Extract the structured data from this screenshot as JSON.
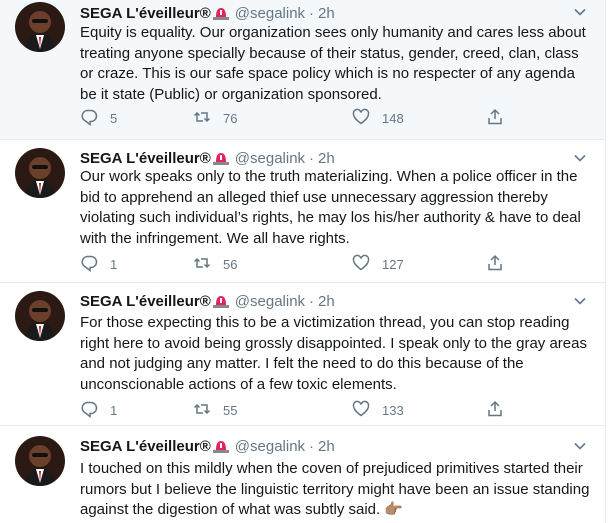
{
  "tweets": [
    {
      "name": "SEGA L'éveilleur®",
      "handle": "@segalink",
      "dot": "·",
      "time": "2h",
      "text": "Equity is equality. Our organization sees only humanity and cares less about treating anyone specially because of their status, gender, creed, clan, class or craze. This is our safe space policy which is no respecter of any agenda be it state (Public) or organization sponsored.",
      "replies": "5",
      "retweets": "76",
      "likes": "148"
    },
    {
      "name": "SEGA L'éveilleur®",
      "handle": "@segalink",
      "dot": "·",
      "time": "2h",
      "text": "Our work speaks only to the truth materializing. When a police officer in the bid to apprehend an alleged thief use unnecessary aggression thereby violating such individual’s rights, he may los his/her authority & have to deal with the infringement. We all have rights.",
      "replies": "1",
      "retweets": "56",
      "likes": "127"
    },
    {
      "name": "SEGA L'éveilleur®",
      "handle": "@segalink",
      "dot": "·",
      "time": "2h",
      "text": "For those expecting this to be a victimization thread, you can stop reading right here to avoid being grossly disappointed. I speak only to the gray areas and not judging any matter. I felt the need to do this because of the unconscionable actions of a few toxic elements.",
      "replies": "1",
      "retweets": "55",
      "likes": "133"
    },
    {
      "name": "SEGA L'éveilleur®",
      "handle": "@segalink",
      "dot": "·",
      "time": "2h",
      "text": "I touched on this mildly when the coven of prejudiced primitives started their rumors but I believe the linguistic territory might have been an issue standing against the digestion of what was subtly said.",
      "emoji": "👉🏽"
    }
  ],
  "icons": {
    "badge": "siren-icon",
    "reply": "reply-icon",
    "retweet": "retweet-icon",
    "like": "heart-icon",
    "share": "share-icon",
    "caret": "chevron-down-icon"
  },
  "colors": {
    "text": "#14171a",
    "secondary": "#657786",
    "divider": "#e6ecf0",
    "siren": "#e0245e"
  }
}
